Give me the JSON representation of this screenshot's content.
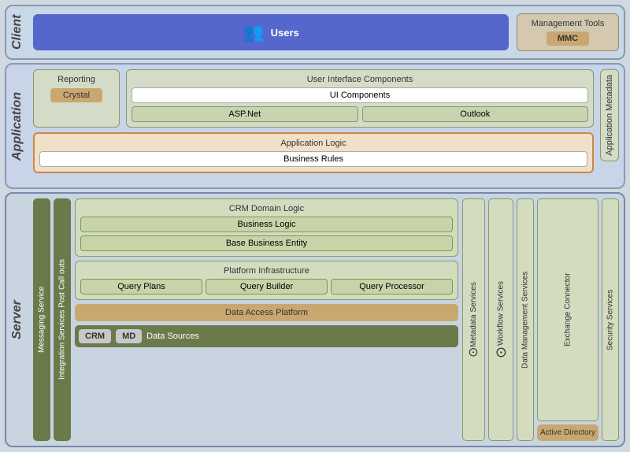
{
  "client": {
    "label": "Client",
    "users": {
      "label": "Users",
      "icon": "👥"
    },
    "management_tools": {
      "label": "Management Tools",
      "mmc": "MMC"
    }
  },
  "application": {
    "label": "Application",
    "reporting": {
      "label": "Reporting",
      "crystal": "Crystal"
    },
    "ui_components": {
      "label": "User Interface Components",
      "ui_comp": "UI Components",
      "asp_net": "ASP.Net",
      "outlook": "Outlook"
    },
    "app_logic": {
      "label": "Application Logic",
      "business_rules": "Business Rules"
    },
    "metadata": "Application Metadata"
  },
  "server": {
    "label": "Server",
    "messaging_service": "Messaging Service",
    "integration_services": "Integration Services Post Call outs",
    "crm_domain": {
      "label": "CRM Domain Logic",
      "business_logic": "Business Logic",
      "base_business_entity": "Base Business Entity"
    },
    "platform": {
      "label": "Platform Infrastructure",
      "query_plans": "Query Plans",
      "query_builder": "Query Builder",
      "query_processor": "Query Processor"
    },
    "data_access": "Data Access Platform",
    "data_sources": {
      "label": "Data Sources",
      "crm": "CRM",
      "md": "MD"
    },
    "metadata_services": "Metadata Services",
    "workflow_services": "Workflow Services",
    "data_management": "Data Management Services",
    "exchange_connector": "Exchange Connector",
    "security_services": "Security Services",
    "active_directory": "Active Directory"
  }
}
